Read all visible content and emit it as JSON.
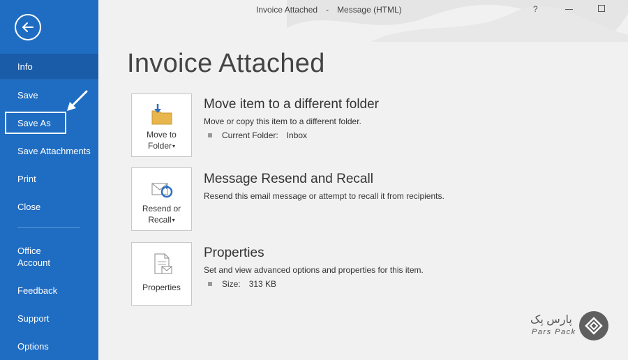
{
  "window": {
    "title": "Invoice Attached",
    "separator": "-",
    "subtitle": "Message (HTML)",
    "help": "?"
  },
  "sidebar": {
    "items": [
      {
        "label": "Info"
      },
      {
        "label": "Save"
      },
      {
        "label": "Save As"
      },
      {
        "label": "Save Attachments"
      },
      {
        "label": "Print"
      },
      {
        "label": "Close"
      },
      {
        "label": "Office Account"
      },
      {
        "label": "Feedback"
      },
      {
        "label": "Support"
      },
      {
        "label": "Options"
      }
    ]
  },
  "main": {
    "page_title": "Invoice Attached",
    "sections": [
      {
        "tile_line1": "Move to",
        "tile_line2": "Folder",
        "title": "Move item to a different folder",
        "desc": "Move or copy this item to a different folder.",
        "detail_label": "Current Folder:",
        "detail_value": "Inbox"
      },
      {
        "tile_line1": "Resend or",
        "tile_line2": "Recall",
        "title": "Message Resend and Recall",
        "desc": "Resend this email message or attempt to recall it from recipients."
      },
      {
        "tile_line1": "Properties",
        "title": "Properties",
        "desc": "Set and view advanced options and properties for this item.",
        "detail_label": "Size:",
        "detail_value": "313 KB"
      }
    ]
  },
  "logo": {
    "fa": "پارس پک",
    "en": "Pars Pack"
  },
  "colors": {
    "sidebar": "#1f6dc2",
    "sidebar_active": "#1a5ca8",
    "background": "#f1f1f1"
  }
}
